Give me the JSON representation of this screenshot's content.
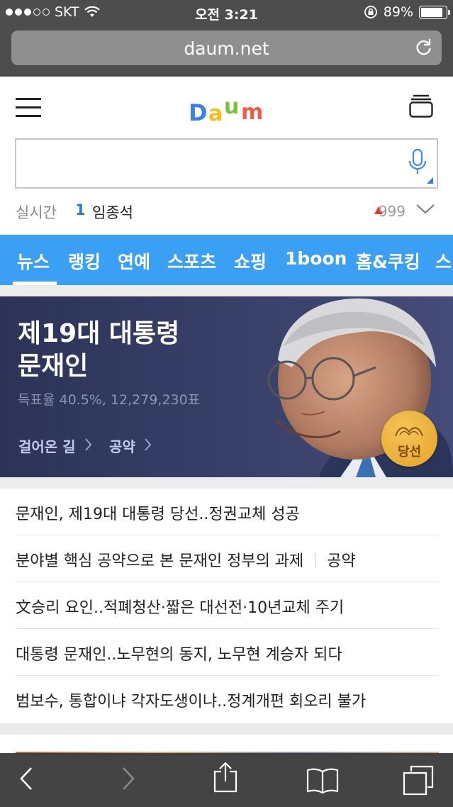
{
  "status": {
    "carrier": "SKT",
    "time": "오전 3:21",
    "battery": "89%",
    "battery_level": 0.89,
    "signal_bars": 3
  },
  "browser": {
    "url": "daum.net"
  },
  "header": {
    "logo_letters": [
      "D",
      "a",
      "u",
      "m"
    ]
  },
  "search": {
    "value": "",
    "placeholder": ""
  },
  "realtime": {
    "label": "실시간",
    "rank": "1",
    "term": "임종석",
    "count": "999"
  },
  "nav": {
    "tabs": [
      "뉴스",
      "랭킹",
      "연예",
      "스포츠",
      "쇼핑",
      "1boon",
      "홈&쿠킹",
      "스"
    ],
    "active": 0
  },
  "banner": {
    "title_line1": "제19대 대통령",
    "title_line2": "문재인",
    "stat": "득표율 40.5%, 12,279,230표",
    "links": [
      "걸어온 길",
      "공약"
    ],
    "badge": "당선"
  },
  "news": [
    {
      "title": "문재인, 제19대 대통령 당선..정권교체 성공"
    },
    {
      "title": "분야별 핵심 공약으로 본 문재인 정부의 과제",
      "tag": "공약"
    },
    {
      "title": "文승리 요인..적폐청산·짧은 대선전·10년교체 주기"
    },
    {
      "title": "대통령 문재인..노무현의 동지, 노무현 계승자 되다"
    },
    {
      "title": "범보수, 통합이냐 각자도생이냐..정계개편 회오리 불가"
    }
  ],
  "colors": {
    "nav_bg": "#3b9ff4",
    "banner_bg": "#353c63",
    "rank": "#2979d6",
    "up_arrow": "#e13b35",
    "logo": [
      "#3b82e8",
      "#f5bd1b",
      "#7fbf3a",
      "#ef5a4b"
    ]
  }
}
